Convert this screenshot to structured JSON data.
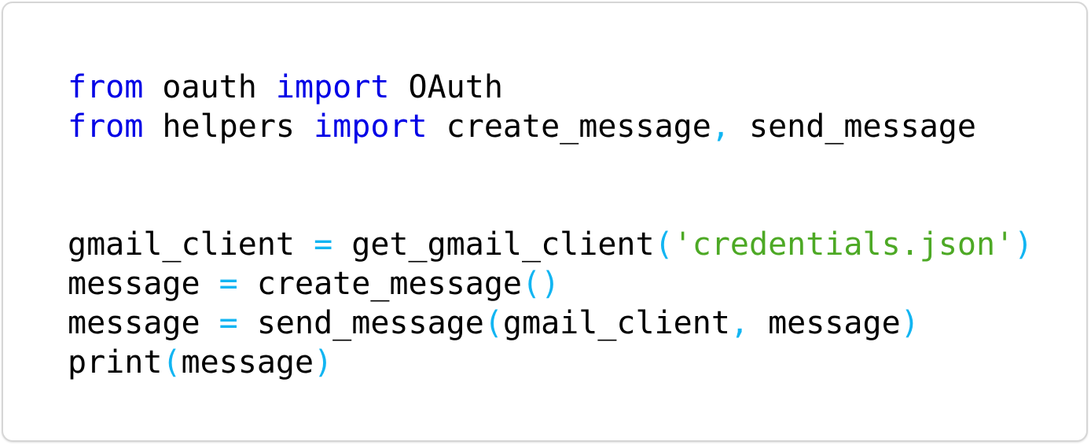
{
  "colors": {
    "keyword": "#0000e6",
    "operator": "#12b5f2",
    "string": "#4da925",
    "text": "#000000",
    "border": "#d6d6d6"
  },
  "code": {
    "line1": {
      "kw_from": "from",
      "module": " oauth ",
      "kw_import": "import",
      "name": " OAuth"
    },
    "line2": {
      "kw_from": "from",
      "module": " helpers ",
      "kw_import": "import",
      "name1": " create_message",
      "comma": ",",
      "name2": " send_message"
    },
    "line5": {
      "var": "gmail_client ",
      "eq": "=",
      "call": " get_gmail_client",
      "lparen": "(",
      "arg": "'credentials.json'",
      "rparen": ")"
    },
    "line6": {
      "var": "message ",
      "eq": "=",
      "call": " create_message",
      "parens": "()"
    },
    "line7": {
      "var": "message ",
      "eq": "=",
      "call": " send_message",
      "lparen": "(",
      "arg1": "gmail_client",
      "comma": ",",
      "arg2": " message",
      "rparen": ")"
    },
    "line8": {
      "call": "print",
      "lparen": "(",
      "arg": "message",
      "rparen": ")"
    }
  }
}
